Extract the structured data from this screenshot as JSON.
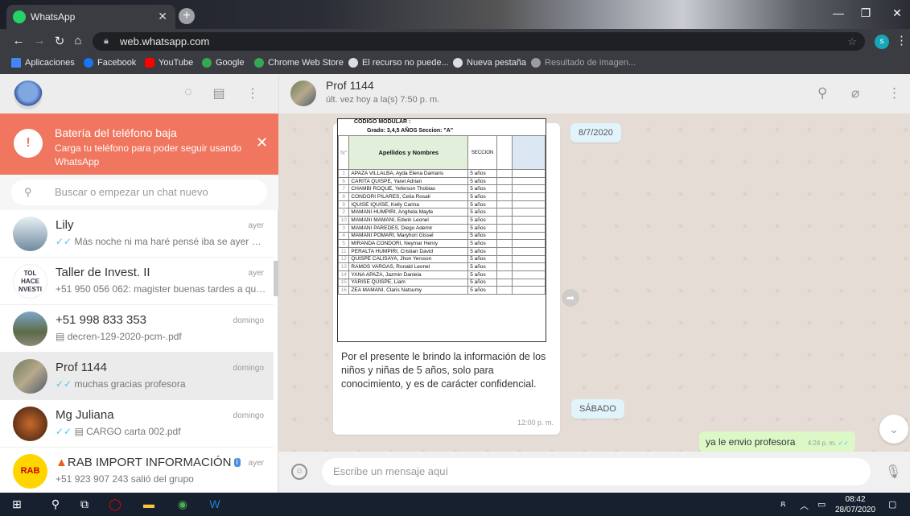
{
  "browser": {
    "tab_title": "WhatsApp",
    "url": "web.whatsapp.com",
    "profile_initial": "s",
    "bookmarks": [
      {
        "label": "Aplicaciones",
        "icon": "apps-grid-icon"
      },
      {
        "label": "Facebook",
        "icon": "facebook-icon"
      },
      {
        "label": "YouTube",
        "icon": "youtube-icon"
      },
      {
        "label": "Google",
        "icon": "google-icon"
      },
      {
        "label": "Chrome Web Store",
        "icon": "chrome-store-icon"
      },
      {
        "label": "El recurso no puede...",
        "icon": "globe-icon"
      },
      {
        "label": "Nueva pestaña",
        "icon": "globe-icon"
      },
      {
        "label": "Resultado de imagen...",
        "icon": "globe-icon"
      }
    ]
  },
  "sidebar": {
    "battery": {
      "title": "Batería del teléfono baja",
      "text": "Carga tu teléfono para poder seguir usando WhatsApp"
    },
    "search_placeholder": "Buscar o empezar un chat nuevo",
    "chats": [
      {
        "name": "Lily",
        "time": "ayer",
        "preview": "Más noche ni ma haré pensé iba se ayer mi ...",
        "ticks": true
      },
      {
        "name": "Taller de Invest. II",
        "time": "ayer",
        "preview": "+51 950 056 062: magister buenas tardes a que...",
        "ticks": false
      },
      {
        "name": "+51 998 833 353",
        "time": "domingo",
        "preview": "decren-129-2020-pcm-.pdf",
        "ticks": false
      },
      {
        "name": "Prof 1144",
        "time": "domingo",
        "preview": "muchas gracias profesora",
        "ticks": true
      },
      {
        "name": "Mg Juliana",
        "time": "domingo",
        "preview": "CARGO  carta  002.pdf",
        "ticks": true
      },
      {
        "name": "RAB IMPORT INFORMACIÓN",
        "time": "ayer",
        "preview": "+51 923 907 243 salió del grupo",
        "ticks": false
      }
    ]
  },
  "conversation": {
    "name": "Prof 1144",
    "status": "últ. vez hoy a la(s) 7:50 p. m.",
    "document": {
      "header1": "CODIGO MODULAR :",
      "header2": "Grado: 3,4,5 AÑOS    Seccion: \"A\"",
      "col_n": "N°",
      "col_name": "Apellidos y Nombres",
      "col_section": "SECCION",
      "rows": [
        {
          "n": "1",
          "name": "APAZA VILLALBA, Ayda Elena Damaris",
          "sec": "5 años"
        },
        {
          "n": "6",
          "name": "CARITA QUISPE, Yarel Adrian",
          "sec": "5 años"
        },
        {
          "n": "7",
          "name": "CHAMBI ROQUE, Yeferson Thobias",
          "sec": "5 años"
        },
        {
          "n": "8",
          "name": "CONDORI PILARES, Celia Rosali",
          "sec": "5 años"
        },
        {
          "n": "9",
          "name": "IQUISE IQUISE, Kelly Carina",
          "sec": "5 años"
        },
        {
          "n": "2",
          "name": "MAMANI HUMPIRI, Anghela Mayte",
          "sec": "5 años"
        },
        {
          "n": "10",
          "name": "MAMANI MAMANI, Edwin Leonel",
          "sec": "5 años"
        },
        {
          "n": "3",
          "name": "MAMANI PAREDES, Diego Ademir",
          "sec": "5 años"
        },
        {
          "n": "4",
          "name": "MAMANI POMARI, Maryhori Gissel",
          "sec": "5 años"
        },
        {
          "n": "5",
          "name": "MIRANDA CONDORI, Neymar Henry",
          "sec": "5 años"
        },
        {
          "n": "11",
          "name": "PERALTA HUMPIRI, Cristian David",
          "sec": "5 años"
        },
        {
          "n": "12",
          "name": "QUISPE CALISAYA, Jhon Yersson",
          "sec": "5 años"
        },
        {
          "n": "13",
          "name": "RAMOS VARGAS, Ronald Leonel",
          "sec": "5 años"
        },
        {
          "n": "14",
          "name": "YANA APAZA, Jazmin Daniela",
          "sec": "5 años"
        },
        {
          "n": "15",
          "name": "YARISE QUISPE, Liam",
          "sec": "5 años"
        },
        {
          "n": "16",
          "name": "ZEA MAMANI, Claris Natsumy",
          "sec": "5 años"
        }
      ]
    },
    "caption": "Por el presente  le brindo la información de los niños y niñas de 5 años, solo para conocimiento, y es de carácter confidencial.",
    "caption_time": "12:00 p. m.",
    "date_chip_1": "8/7/2020",
    "date_chip_2": "SÁBADO",
    "out_message": "ya le envio profesora",
    "out_time": "4:24 p. m.",
    "composer_placeholder": "Escribe un mensaje aquí"
  },
  "taskbar": {
    "time": "08:42",
    "date": "28/07/2020"
  }
}
